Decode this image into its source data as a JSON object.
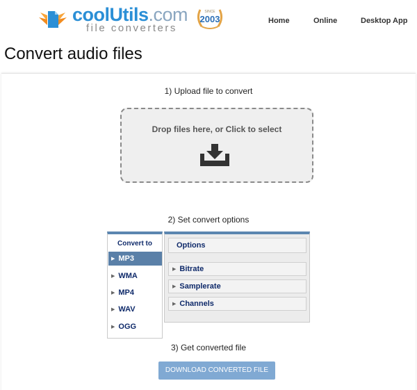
{
  "header": {
    "logo": {
      "cool": "cool",
      "utils": "Utils",
      "com": ".com",
      "tagline": "file converters",
      "since_label": "SINCE",
      "since_year": "2003"
    },
    "nav": {
      "home": "Home",
      "online": "Online",
      "desktop": "Desktop App"
    }
  },
  "page": {
    "title": "Convert audio files"
  },
  "steps": {
    "upload": "1) Upload file to convert",
    "options": "2) Set convert options",
    "get_file": "3) Get converted file"
  },
  "dropzone": {
    "text": "Drop files here, or Click to select",
    "icon": "download-tray-icon"
  },
  "convert_to": {
    "header": "Convert to",
    "formats": [
      "MP3",
      "WMA",
      "MP4",
      "WAV",
      "OGG"
    ],
    "selected": "MP3"
  },
  "options_panel": {
    "header": "Options",
    "sections": [
      "Bitrate",
      "Samplerate",
      "Channels"
    ]
  },
  "download_button": {
    "label": "DOWNLOAD CONVERTED FILE"
  },
  "colors": {
    "brand_blue": "#2b8fd6",
    "accent": "#5a80a8",
    "button": "#80a9d3",
    "label_text": "#0f2a6a"
  }
}
